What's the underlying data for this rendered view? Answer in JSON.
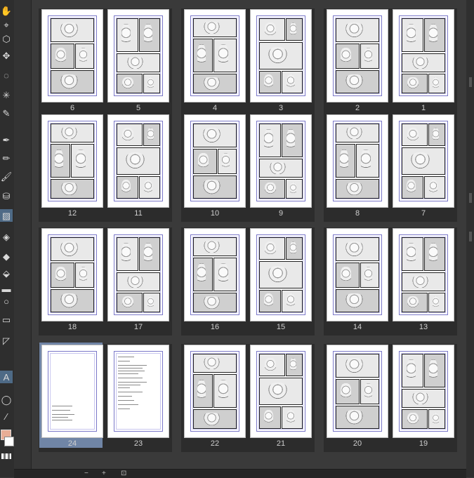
{
  "toolbar": {
    "tools": [
      {
        "name": "hand-icon",
        "glyph": "✋"
      },
      {
        "name": "zoom-icon",
        "glyph": "⌖"
      },
      {
        "name": "object-icon",
        "glyph": "⬡"
      },
      {
        "name": "move-icon",
        "glyph": "✥"
      },
      {
        "name": "lasso-icon",
        "glyph": "◌"
      },
      {
        "name": "magic-wand-icon",
        "glyph": "✳"
      },
      {
        "name": "eyedropper-icon",
        "glyph": "✎"
      },
      {
        "name": "pen-icon",
        "glyph": "✒"
      },
      {
        "name": "pencil-icon",
        "glyph": "✏"
      },
      {
        "name": "brush-icon",
        "glyph": "🖌"
      },
      {
        "name": "airbrush-icon",
        "glyph": "⛁"
      },
      {
        "name": "decoration-icon",
        "glyph": "▨"
      },
      {
        "name": "blend-icon",
        "glyph": "◈"
      },
      {
        "name": "eraser-icon",
        "glyph": "◆"
      },
      {
        "name": "fill-icon",
        "glyph": "⬙"
      },
      {
        "name": "gradient-icon",
        "glyph": "▬"
      },
      {
        "name": "figure-icon",
        "glyph": "○"
      },
      {
        "name": "frame-icon",
        "glyph": "▭"
      },
      {
        "name": "ruler-icon",
        "glyph": "◸"
      },
      {
        "name": "text-icon",
        "glyph": "A"
      },
      {
        "name": "balloon-icon",
        "glyph": "◯"
      },
      {
        "name": "correct-line-icon",
        "glyph": "∕"
      }
    ],
    "main_color": "#e8ad96",
    "sub_color": "#ffffff"
  },
  "pages": {
    "n6": "6",
    "n5": "5",
    "n4": "4",
    "n3": "3",
    "n2": "2",
    "n1": "1",
    "n12": "12",
    "n11": "11",
    "n10": "10",
    "n9": "9",
    "n8": "8",
    "n7": "7",
    "n18": "18",
    "n17": "17",
    "n16": "16",
    "n15": "15",
    "n14": "14",
    "n13": "13",
    "n24": "24",
    "n23": "23",
    "n22": "22",
    "n21": "21",
    "n20": "20",
    "n19": "19"
  },
  "selected_page": "24",
  "bottombar": {
    "minus": "−",
    "plus": "+",
    "fit": "⊡"
  }
}
